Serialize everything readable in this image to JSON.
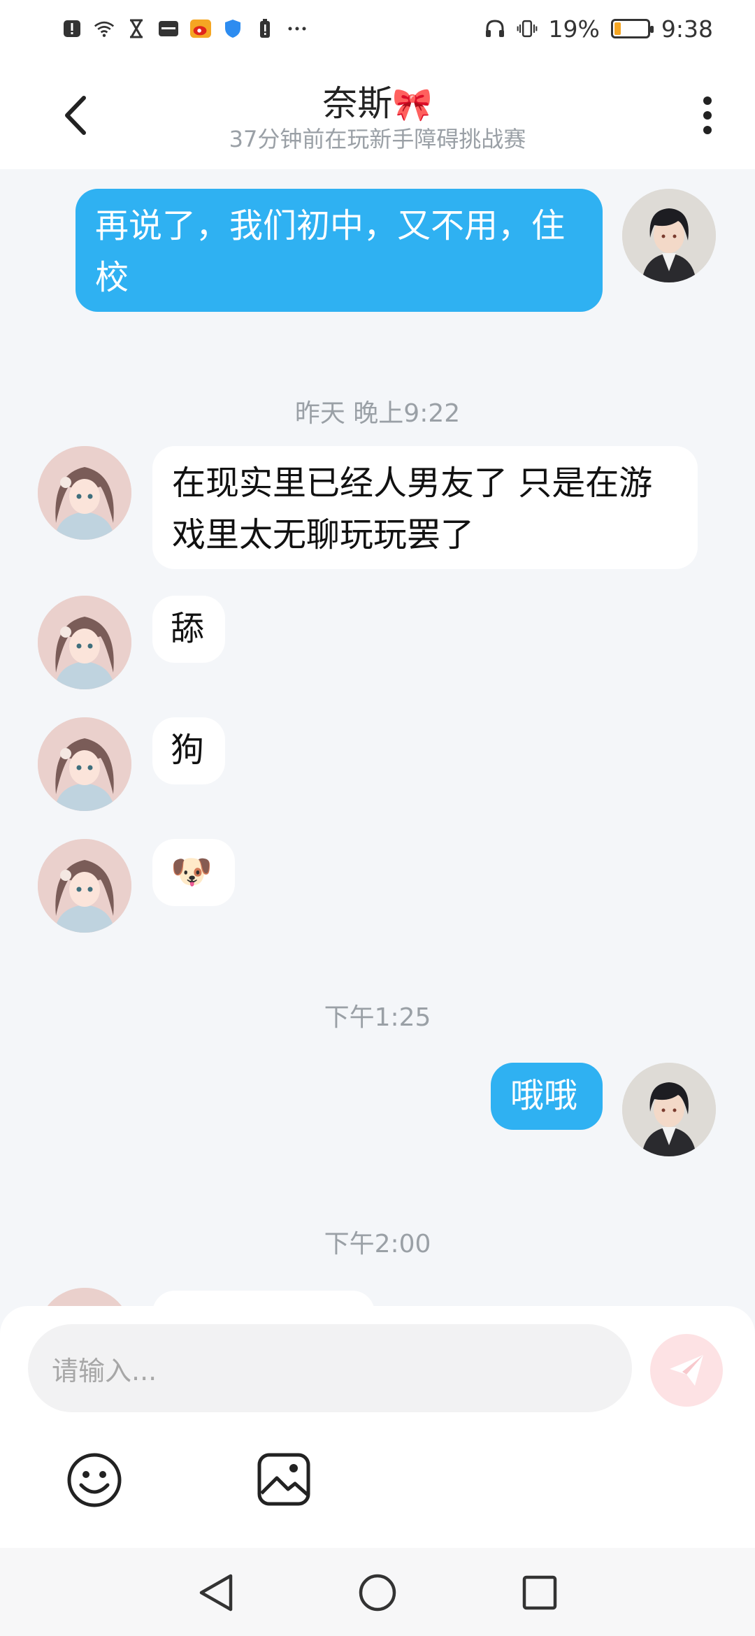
{
  "status_bar": {
    "battery_percent": "19%",
    "battery_level": 0.19,
    "time": "9:38",
    "left_icons": [
      "alert-icon",
      "wifi-icon",
      "hourglass-icon",
      "huawei-icon",
      "weibo-icon",
      "shield-icon",
      "battery-alert-icon",
      "more-dots-icon"
    ],
    "right_icons": [
      "headphones-icon",
      "vibrate-icon",
      "battery-icon"
    ]
  },
  "header": {
    "title": "奈斯",
    "title_emoji": "🎀",
    "subtitle": "37分钟前在玩新手障碍挑战赛"
  },
  "messages": {
    "m1": "再说了，我们初中，又不用，住校",
    "ts1": "昨天 晚上9:22",
    "m2": "在现实里已经人男友了  只是在游戏里太无聊玩玩罢了",
    "m3": "舔",
    "m4": "狗",
    "m5": "🐶",
    "ts2": "下午1:25",
    "m6": "哦哦",
    "ts3": "下午2:00"
  },
  "input": {
    "placeholder": "请输入..."
  },
  "colors": {
    "my_bubble": "#2fb1f2",
    "her_bubble": "#ffffff",
    "background": "#f4f6f9",
    "send_button": "#fde2e4"
  }
}
